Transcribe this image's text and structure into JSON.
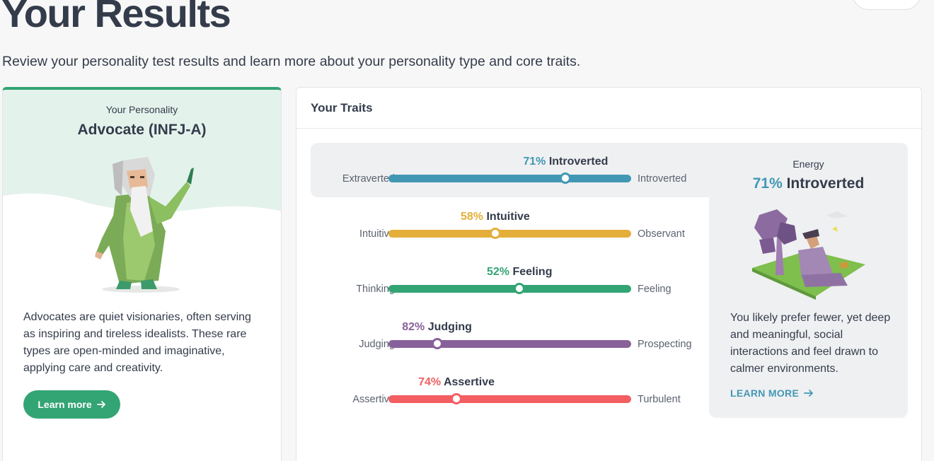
{
  "page": {
    "title": "Your Results",
    "subtitle": "Review your personality test results and learn more about your personality type and core traits."
  },
  "personality": {
    "label": "Your Personality",
    "name": "Advocate (INFJ-A)",
    "description": "Advocates are quiet visionaries, often serving as inspiring and tireless idealists. These rare types are open-minded and imaginative, applying care and creativity.",
    "button_label": "Learn more",
    "button_icon": "arrow-right-icon",
    "accent_color": "#33a474"
  },
  "traits": {
    "header": "Your Traits",
    "rows": [
      {
        "percent": "71%",
        "label": "Introverted",
        "left": "Extraverted",
        "right": "Introverted",
        "color": "#4298b4",
        "position": 0.73
      },
      {
        "percent": "58%",
        "label": "Intuitive",
        "left": "Intuitive",
        "right": "Observant",
        "color": "#e4ae3a",
        "position": 0.44
      },
      {
        "percent": "52%",
        "label": "Feeling",
        "left": "Thinking",
        "right": "Feeling",
        "color": "#33a474",
        "position": 0.54
      },
      {
        "percent": "82%",
        "label": "Judging",
        "left": "Judging",
        "right": "Prospecting",
        "color": "#88619a",
        "position": 0.2
      },
      {
        "percent": "74%",
        "label": "Assertive",
        "left": "Assertive",
        "right": "Turbulent",
        "color": "#f25e62",
        "position": 0.28
      }
    ]
  },
  "energy": {
    "label": "Energy",
    "percent": "71%",
    "trait": "Introverted",
    "description": "You likely prefer fewer, yet deep and meaningful, social interactions and feel drawn to calmer environments.",
    "link_label": "LEARN MORE",
    "link_icon": "arrow-right-icon",
    "accent_color": "#4298b4"
  }
}
